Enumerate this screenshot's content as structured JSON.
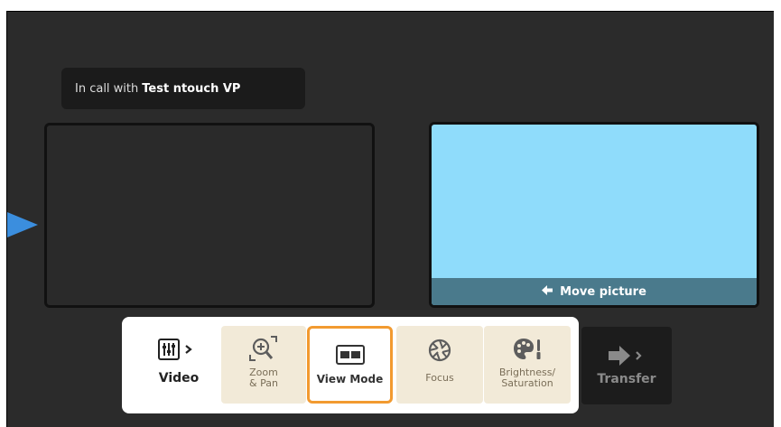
{
  "call": {
    "prefix": "In call with",
    "contact": "Test ntouch VP"
  },
  "self_view": {
    "move_label": "Move picture"
  },
  "toolbar": {
    "video_label": "Video",
    "zoom_label_1": "Zoom",
    "zoom_label_2": "& Pan",
    "view_mode_label": "View Mode",
    "focus_label": "Focus",
    "brightness_label_1": "Brightness/",
    "brightness_label_2": "Saturation",
    "transfer_label": "Transfer"
  },
  "colors": {
    "accent": "#f29a30",
    "self_view_bg": "#8fdcfb",
    "pointer": "#3b8ede"
  },
  "icons": {
    "video": "sliders-icon",
    "zoom": "zoom-pan-icon",
    "view_mode": "view-mode-icon",
    "focus": "aperture-icon",
    "brightness": "palette-icon",
    "transfer": "arrow-right-icon"
  }
}
